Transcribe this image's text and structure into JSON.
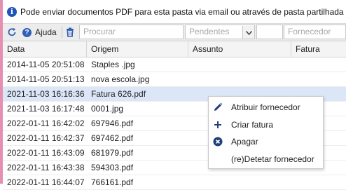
{
  "info_bar": {
    "text": "Pode enviar documentos PDF para esta pasta via email ou através de pasta partilhada",
    "icon": "info-icon"
  },
  "toolbar": {
    "help_label": "Ajuda",
    "search_placeholder": "Procurar",
    "status_value": "Pendentes",
    "supplier_placeholder": "Fornecedor"
  },
  "table": {
    "columns": [
      "Data",
      "Origem",
      "Assunto",
      "Fatura"
    ],
    "rows": [
      {
        "data": "2014-11-05 20:51:08",
        "origem": "Staples .jpg"
      },
      {
        "data": "2014-11-05 20:51:13",
        "origem": "nova escola.jpg"
      },
      {
        "data": "2021-11-03 16:16:36",
        "origem": "Fatura 626.pdf",
        "selected": true
      },
      {
        "data": "2021-11-03 16:17:48",
        "origem": "0001.jpg"
      },
      {
        "data": "2022-01-11 16:42:02",
        "origem": "697946.pdf"
      },
      {
        "data": "2022-01-11 16:42:37",
        "origem": "697462.pdf"
      },
      {
        "data": "2022-01-11 16:43:09",
        "origem": "681979.pdf"
      },
      {
        "data": "2022-01-11 16:43:38",
        "origem": "594303.pdf"
      },
      {
        "data": "2022-01-11 16:44:07",
        "origem": "766161.pdf"
      }
    ]
  },
  "context_menu": {
    "items": [
      {
        "label": "Atribuir fornecedor",
        "icon": "pencil-icon"
      },
      {
        "label": "Criar fatura",
        "icon": "plus-icon"
      },
      {
        "label": "Apagar",
        "icon": "delete-circle-icon"
      },
      {
        "label": "(re)Detetar fornecedor",
        "icon": ""
      }
    ]
  },
  "colors": {
    "accent": "#1f55b7",
    "left_strip": "#e58fb3",
    "selected_row": "#dbe6f6"
  }
}
